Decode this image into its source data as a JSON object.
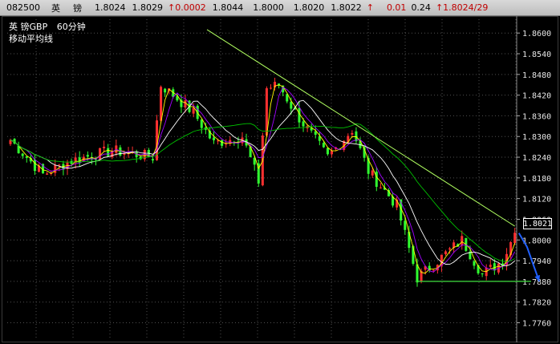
{
  "quote_bar": {
    "time": "082500",
    "name1": "英",
    "name2": "镑",
    "open": "1.8024",
    "high": "1.8029",
    "change": "0.0002",
    "v4": "1.8044",
    "v5": "1.8000",
    "v6": "1.8020",
    "v7": "1.8022",
    "pct": "0.01",
    "v9": "0.24",
    "bidask": "1.8024/29"
  },
  "legend": {
    "symbol": "英    镑GBP",
    "period": "60分钟",
    "indicator": "移动平均线"
  },
  "current_price_label": "1.8021",
  "colors": {
    "up_candle": "#ff3030",
    "down_candle": "#30ff30",
    "ma1": "#ffffff",
    "ma2": "#ffff00",
    "ma3": "#a000ff",
    "ma4": "#00c000",
    "trendline": "#b0ff60",
    "support": "#40e040",
    "forecast_arrow": "#2060ff",
    "grid": "#505050"
  },
  "chart_data": {
    "type": "candlestick",
    "y_axis_side": "right",
    "ylim": [
      1.771,
      1.864
    ],
    "y_ticks": [
      "1.8600",
      "1.8540",
      "1.8480",
      "1.8420",
      "1.8360",
      "1.8300",
      "1.8240",
      "1.8180",
      "1.8120",
      "1.8060",
      "1.8000",
      "1.7940",
      "1.7880",
      "1.7820",
      "1.7760"
    ],
    "grid": true,
    "num_bars": 125,
    "key_points": [
      {
        "bar": 0,
        "close": 1.829
      },
      {
        "bar": 8,
        "close": 1.819
      },
      {
        "bar": 15,
        "close": 1.823
      },
      {
        "bar": 25,
        "close": 1.826
      },
      {
        "bar": 35,
        "close": 1.824
      },
      {
        "bar": 37,
        "close": 1.845
      },
      {
        "bar": 45,
        "close": 1.837
      },
      {
        "bar": 50,
        "close": 1.828
      },
      {
        "bar": 57,
        "close": 1.83
      },
      {
        "bar": 61,
        "close": 1.817
      },
      {
        "bar": 63,
        "close": 1.844
      },
      {
        "bar": 66,
        "close": 1.845
      },
      {
        "bar": 70,
        "close": 1.837
      },
      {
        "bar": 78,
        "close": 1.824
      },
      {
        "bar": 84,
        "close": 1.832
      },
      {
        "bar": 88,
        "close": 1.82
      },
      {
        "bar": 95,
        "close": 1.81
      },
      {
        "bar": 100,
        "close": 1.789
      },
      {
        "bar": 106,
        "close": 1.795
      },
      {
        "bar": 111,
        "close": 1.8
      },
      {
        "bar": 116,
        "close": 1.79
      },
      {
        "bar": 121,
        "close": 1.794
      },
      {
        "bar": 124,
        "close": 1.8021
      }
    ],
    "trendline": {
      "from": [
        1.861,
        0
      ],
      "to": [
        1.804,
        124
      ]
    },
    "support_line": {
      "price": 1.788,
      "from_bar": 100,
      "to_bar": 128
    },
    "forecast": {
      "from": [
        1.802,
        125
      ],
      "via": [
        1.798,
        127
      ],
      "to": [
        1.788,
        130
      ]
    }
  }
}
